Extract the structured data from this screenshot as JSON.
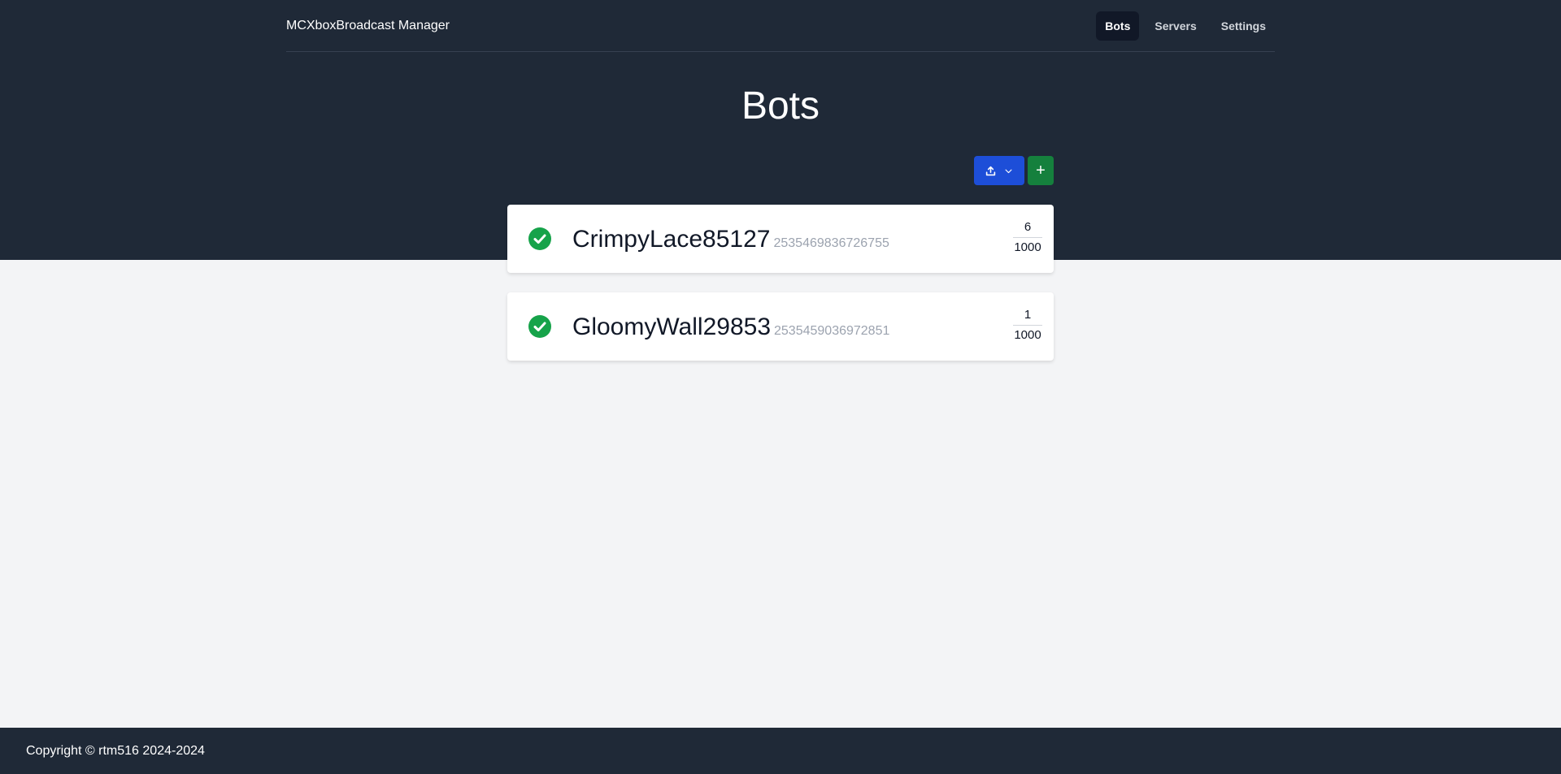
{
  "app": {
    "brand": "MCXboxBroadcast Manager"
  },
  "nav": {
    "items": [
      {
        "label": "Bots",
        "active": true
      },
      {
        "label": "Servers",
        "active": false
      },
      {
        "label": "Settings",
        "active": false
      }
    ]
  },
  "page": {
    "title": "Bots"
  },
  "toolbar": {
    "export_icon": "upload-icon",
    "export_chevron_icon": "chevron-down-icon",
    "add_label": "+"
  },
  "bots": [
    {
      "name": "CrimpyLace85127",
      "id": "2535469836726755",
      "current": "6",
      "max": "1000",
      "status": "online"
    },
    {
      "name": "GloomyWall29853",
      "id": "2535459036972851",
      "current": "1",
      "max": "1000",
      "status": "online"
    }
  ],
  "colors": {
    "hero_bg": "#1f2937",
    "page_bg": "#f3f4f6",
    "export_button": "#1d4ed8",
    "add_button": "#15803d",
    "status_ok": "#16a34a"
  },
  "footer": {
    "text": "Copyright © rtm516 2024-2024"
  }
}
